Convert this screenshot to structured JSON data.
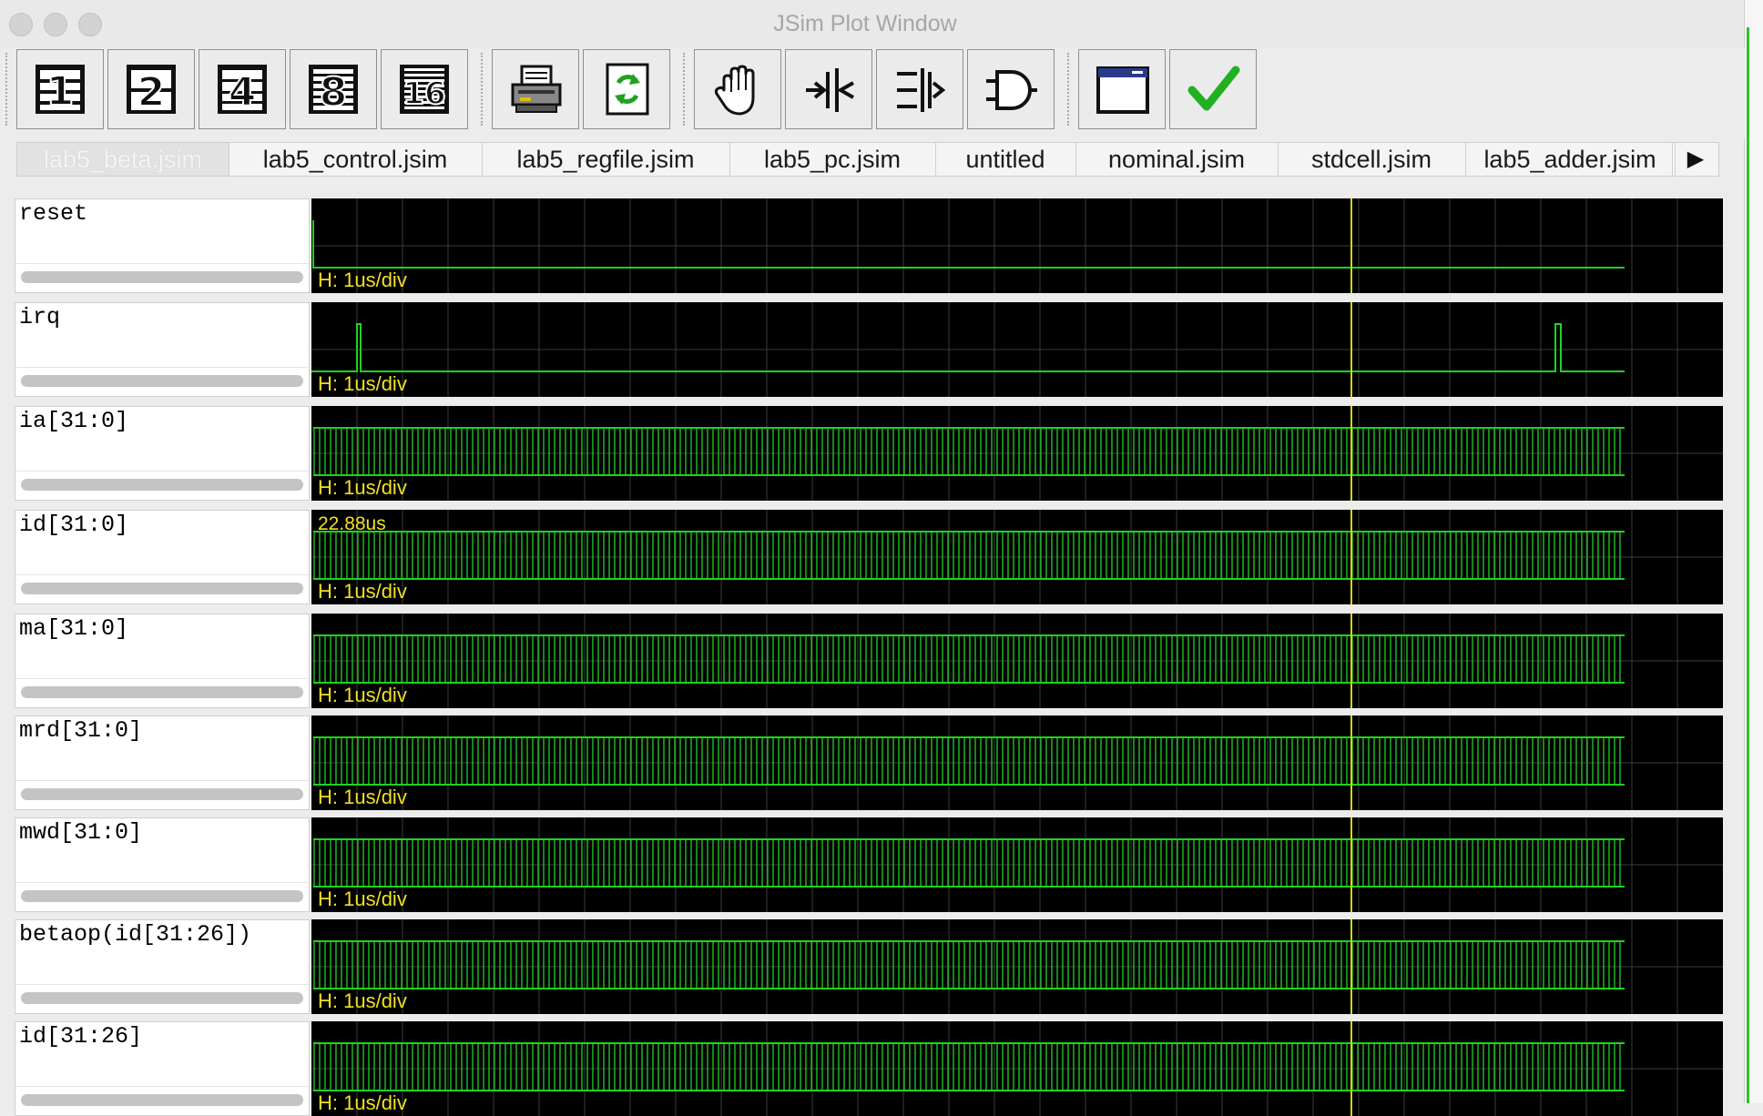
{
  "window": {
    "title": "JSim Plot Window",
    "buttons": [
      "close",
      "minimize",
      "zoom"
    ]
  },
  "toolbar": {
    "buttons": [
      {
        "name": "one-plot-per-row-icon",
        "glyph": "1"
      },
      {
        "name": "two-plots-icon",
        "glyph": "2"
      },
      {
        "name": "four-plots-icon",
        "glyph": "4"
      },
      {
        "name": "eight-plots-icon",
        "glyph": "8"
      },
      {
        "name": "sixteen-plots-icon",
        "glyph": "16"
      },
      {
        "name": "print-icon"
      },
      {
        "name": "refresh-icon"
      },
      {
        "name": "pan-hand-icon"
      },
      {
        "name": "zoom-in-icon"
      },
      {
        "name": "zoom-out-icon"
      },
      {
        "name": "gate-icon"
      },
      {
        "name": "window-icon"
      },
      {
        "name": "checkmark-icon",
        "color": "#22b022"
      }
    ]
  },
  "tabs": [
    {
      "label": "lab5_beta.jsim",
      "active": true
    },
    {
      "label": "lab5_control.jsim"
    },
    {
      "label": "lab5_regfile.jsim"
    },
    {
      "label": "lab5_pc.jsim"
    },
    {
      "label": "untitled"
    },
    {
      "label": "nominal.jsim"
    },
    {
      "label": "stdcell.jsim"
    },
    {
      "label": "lab5_adder.jsim"
    }
  ],
  "tab_scroll_glyph": "▶",
  "cursor_readout": "22.88us",
  "colors": {
    "trace": "#22d022",
    "grid": "#3c3c3c",
    "cursor": "#d8d800",
    "label": "#f0e022",
    "plot_bg": "#000000"
  },
  "signals": [
    {
      "name": "reset",
      "scale": "H: 1us/div",
      "kind": "reset"
    },
    {
      "name": "irq",
      "scale": "H: 1us/div",
      "kind": "irq"
    },
    {
      "name": "ia[31:0]",
      "scale": "H: 1us/div",
      "kind": "bus"
    },
    {
      "name": "id[31:0]",
      "scale": "H: 1us/div",
      "kind": "bus"
    },
    {
      "name": "ma[31:0]",
      "scale": "H: 1us/div",
      "kind": "bus"
    },
    {
      "name": "mrd[31:0]",
      "scale": "H: 1us/div",
      "kind": "bus"
    },
    {
      "name": "mwd[31:0]",
      "scale": "H: 1us/div",
      "kind": "bus"
    },
    {
      "name": "betaop(id[31:26])",
      "scale": "H: 1us/div",
      "kind": "bus"
    },
    {
      "name": "id[31:26]",
      "scale": "H: 1us/div",
      "kind": "bus"
    }
  ]
}
